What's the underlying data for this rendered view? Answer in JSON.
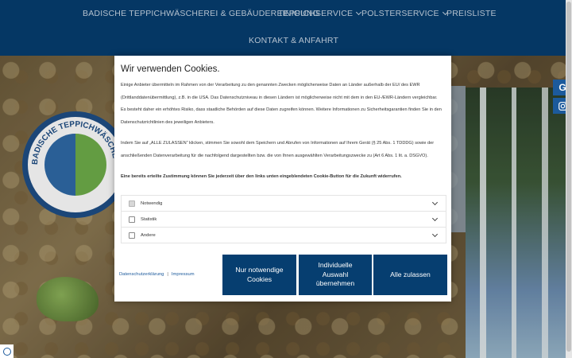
{
  "nav": {
    "items": [
      {
        "label": "BADISCHE TEPPICHWÄSCHEREI & GEBÄUDEREINIGUNG",
        "has_dropdown": false
      },
      {
        "label": "TEPPICHSERVICE",
        "has_dropdown": true
      },
      {
        "label": "POLSTERSERVICE",
        "has_dropdown": true
      },
      {
        "label": "PREISLISTE",
        "has_dropdown": false
      },
      {
        "label": "KONTAKT & ANFAHRT",
        "has_dropdown": false
      }
    ]
  },
  "logo": {
    "text": "BADISCHE TEPPICHWÄSCHE"
  },
  "social": [
    {
      "label": "G",
      "icon": "google-icon"
    },
    {
      "icon": "instagram-icon"
    }
  ],
  "cookie_dialog": {
    "title": "Wir verwenden Cookies.",
    "paragraphs": [
      "Einige Anbieter übermitteln im Rahmen von der Verarbeitung zu den genannten Zwecken möglicherweise Daten an Länder außerhalb der EU/ des EWR (Drittlanddatenübermittlung), z.B. in die USA. Das Datenschutzniveau in diesen Ländern ist möglicherweise nicht mit dem in den EU-/EWR-Ländern vergleichbar. Es besteht daher ein erhöhtes Risiko, dass staatliche Behörden auf diese Daten zugreifen können. Weitere Informationen zu Sicherheitsgarantien finden Sie in den Datenschutzrichtlinien des jeweiligen Anbieters.",
      "Indem Sie auf „ALLE ZULASSEN“ klicken, stimmen Sie sowohl dem Speichern und Abrufen von Informationen auf Ihrem Gerät (§ 25 Abs. 1 TDDDG) sowie der anschließenden Datenverarbeitung für die nachfolgend dargestellten bzw. die von Ihnen ausgewählten Verarbeitungszwecke zu (Art 6 Abs. 1 lit. a. DSGVO).",
      "Eine bereits erteilte Zustimmung können Sie jederzeit über den links unten eingeblendeten Cookie-Button für die Zukunft widerrufen."
    ],
    "categories": [
      {
        "label": "Notwendig",
        "checked": true,
        "disabled": true
      },
      {
        "label": "Statistik",
        "checked": false
      },
      {
        "label": "Andere",
        "checked": false
      }
    ],
    "links": {
      "privacy": "Datenschutzerklärung",
      "separator": "|",
      "imprint": "Impressum"
    },
    "buttons": {
      "necessary": "Nur notwendige Cookies",
      "individual": "Individuelle Auswahl übernehmen",
      "accept_all": "Alle zulassen"
    }
  },
  "colors": {
    "brand": "#063e70",
    "nav_text": "#c9d7e6",
    "link": "#1c5a9c"
  }
}
